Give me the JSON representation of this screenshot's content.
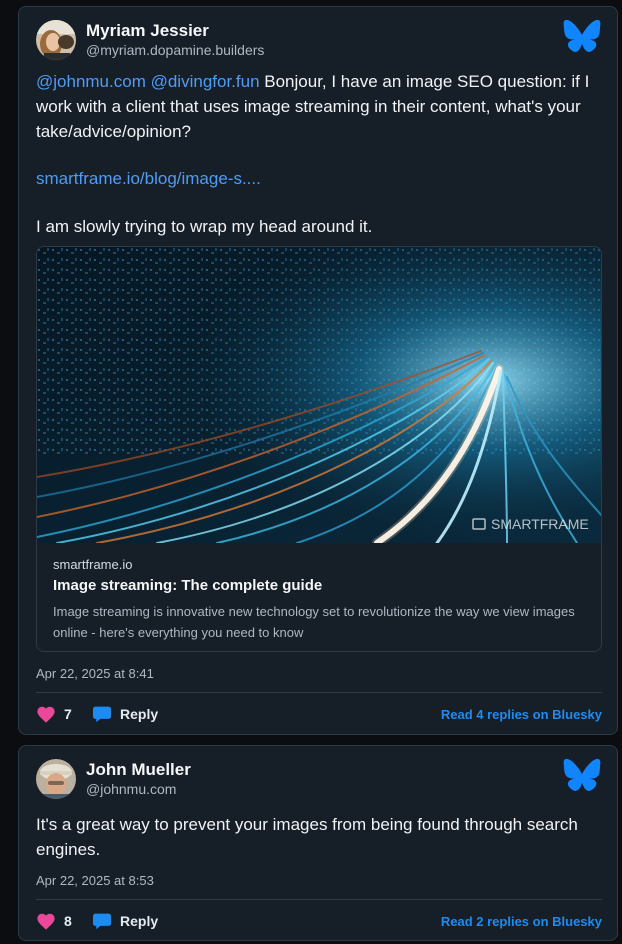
{
  "posts": [
    {
      "author": {
        "name": "Myriam Jessier",
        "handle": "@myriam.dopamine.builders"
      },
      "text": {
        "mention1": "@johnmu.com",
        "mention2": "@divingfor.fun",
        "body1": " Bonjour, I have an image SEO question: if I work with a client that uses image streaming in their content, what's your take/advice/opinion?",
        "link": "smartframe.io/blog/image-s....",
        "body2": "I am slowly trying to wrap my head around it."
      },
      "embed": {
        "watermark": "SMARTFRAME",
        "domain": "smartframe.io",
        "title": "Image streaming: The complete guide",
        "description": "Image streaming is innovative new technology set to revolutionize the way we view images online - here's everything you need to know"
      },
      "timestamp": "Apr 22, 2025 at 8:41",
      "likes": "7",
      "reply_label": "Reply",
      "read_more": "Read 4 replies on Bluesky"
    },
    {
      "author": {
        "name": "John Mueller",
        "handle": "@johnmu.com"
      },
      "text": {
        "body1": "It's a great way to prevent your images from being found through search engines."
      },
      "timestamp": "Apr 22, 2025 at 8:53",
      "likes": "8",
      "reply_label": "Reply",
      "read_more": "Read 2 replies on Bluesky"
    }
  ],
  "colors": {
    "card_bg": "#161e27",
    "link": "#4f9cf5",
    "read_more": "#1b8cf2",
    "heart": "#ec4899",
    "bluesky": "#1185fe"
  },
  "icons": [
    "bluesky-butterfly-icon",
    "heart-icon",
    "reply-bubble-icon"
  ]
}
